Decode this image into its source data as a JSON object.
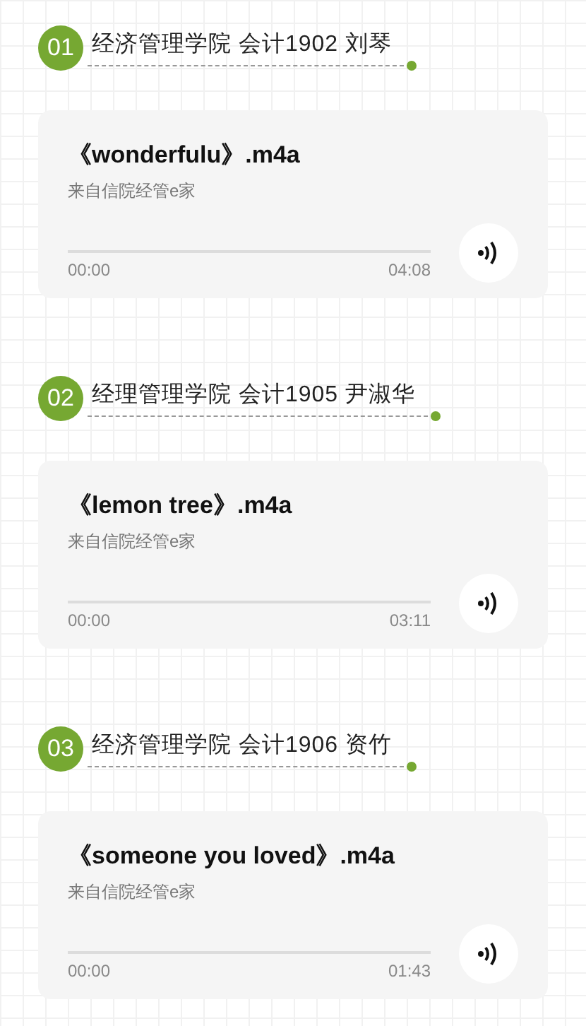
{
  "tracks": [
    {
      "number": "01",
      "heading": "经济管理学院 会计1902 刘琴",
      "title": "《wonderfulu》.m4a",
      "source": "来自信院经管e家",
      "elapsed": "00:00",
      "duration": "04:08",
      "level": 0
    },
    {
      "number": "02",
      "heading": "经理管理学院 会计1905 尹淑华",
      "title": "《lemon tree》.m4a",
      "source": "来自信院经管e家",
      "elapsed": "00:00",
      "duration": "03:11",
      "level": 0
    },
    {
      "number": "03",
      "heading": "经济管理学院 会计1906 资竹",
      "title": "《someone you loved》.m4a",
      "source": "来自信院经管e家",
      "elapsed": "00:00",
      "duration": "01:43",
      "level": 0
    }
  ]
}
